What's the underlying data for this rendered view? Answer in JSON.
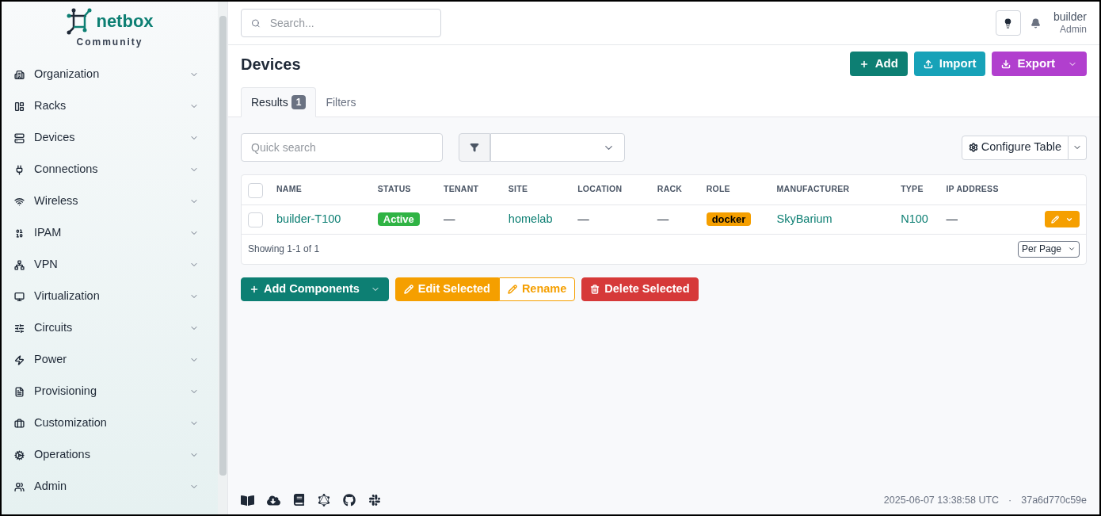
{
  "sidebar": {
    "logo_text": "netbox",
    "logo_subtitle": "Community",
    "items": [
      {
        "label": "Organization",
        "expanded": false
      },
      {
        "label": "Racks",
        "expanded": false
      },
      {
        "label": "Devices",
        "expanded": false
      },
      {
        "label": "Connections",
        "expanded": false
      },
      {
        "label": "Wireless",
        "expanded": false
      },
      {
        "label": "IPAM",
        "expanded": false
      },
      {
        "label": "VPN",
        "expanded": false
      },
      {
        "label": "Virtualization",
        "expanded": false
      },
      {
        "label": "Circuits",
        "expanded": false
      },
      {
        "label": "Power",
        "expanded": false
      },
      {
        "label": "Provisioning",
        "expanded": false
      },
      {
        "label": "Customization",
        "expanded": false
      },
      {
        "label": "Operations",
        "expanded": false
      },
      {
        "label": "Admin",
        "expanded": false
      }
    ]
  },
  "header": {
    "search": {
      "placeholder": "Search..."
    },
    "user": {
      "name": "builder",
      "role": "Admin"
    }
  },
  "page": {
    "title": "Devices",
    "actions": [
      {
        "label": "Add",
        "color": "#0d7f73",
        "dropdown": false
      },
      {
        "label": "Import",
        "color": "#17a2b8",
        "dropdown": false
      },
      {
        "label": "Export",
        "color": "#b13fce",
        "dropdown": true
      }
    ],
    "tabs": [
      {
        "label": "Results",
        "count": "1",
        "selected": true
      },
      {
        "label": "Filters",
        "selected": false
      }
    ]
  },
  "toolbar": {
    "quick_search": {
      "placeholder": "Quick search"
    },
    "configure_button": "Configure Table"
  },
  "table": {
    "all_selected": false,
    "columns": [
      "NAME",
      "STATUS",
      "TENANT",
      "SITE",
      "LOCATION",
      "RACK",
      "ROLE",
      "MANUFACTURER",
      "TYPE",
      "IP ADDRESS"
    ],
    "rows": [
      {
        "selected": false,
        "cells": [
          {
            "kind": "link",
            "text": "builder-T100"
          },
          {
            "kind": "badge",
            "text": "Active",
            "color": "#2fb344"
          },
          {
            "kind": "text",
            "text": "—"
          },
          {
            "kind": "link",
            "text": "homelab"
          },
          {
            "kind": "text",
            "text": "—"
          },
          {
            "kind": "text",
            "text": "—"
          },
          {
            "kind": "badge",
            "text": "docker",
            "color": "#f59f00"
          },
          {
            "kind": "link",
            "text": "SkyBarium"
          },
          {
            "kind": "link",
            "text": "N100"
          },
          {
            "kind": "text",
            "text": "—"
          }
        ]
      }
    ],
    "footer_text": "Showing 1-1 of 1",
    "per_page": "Per Page"
  },
  "bulk_actions": [
    {
      "label": "Add Components",
      "color": "#0d7f73",
      "dropdown": true
    },
    {
      "label": "Edit Selected",
      "color": "#f59f00",
      "dropdown": false
    },
    {
      "label": "Rename",
      "color": "#f59f00",
      "dropdown": false
    },
    {
      "label": "Delete Selected",
      "color": "#d63939",
      "dropdown": false
    }
  ],
  "status_bar": {
    "timestamp": "2025-06-07 13:38:58 UTC",
    "separator": "·",
    "commit": "37a6d770c59e"
  }
}
